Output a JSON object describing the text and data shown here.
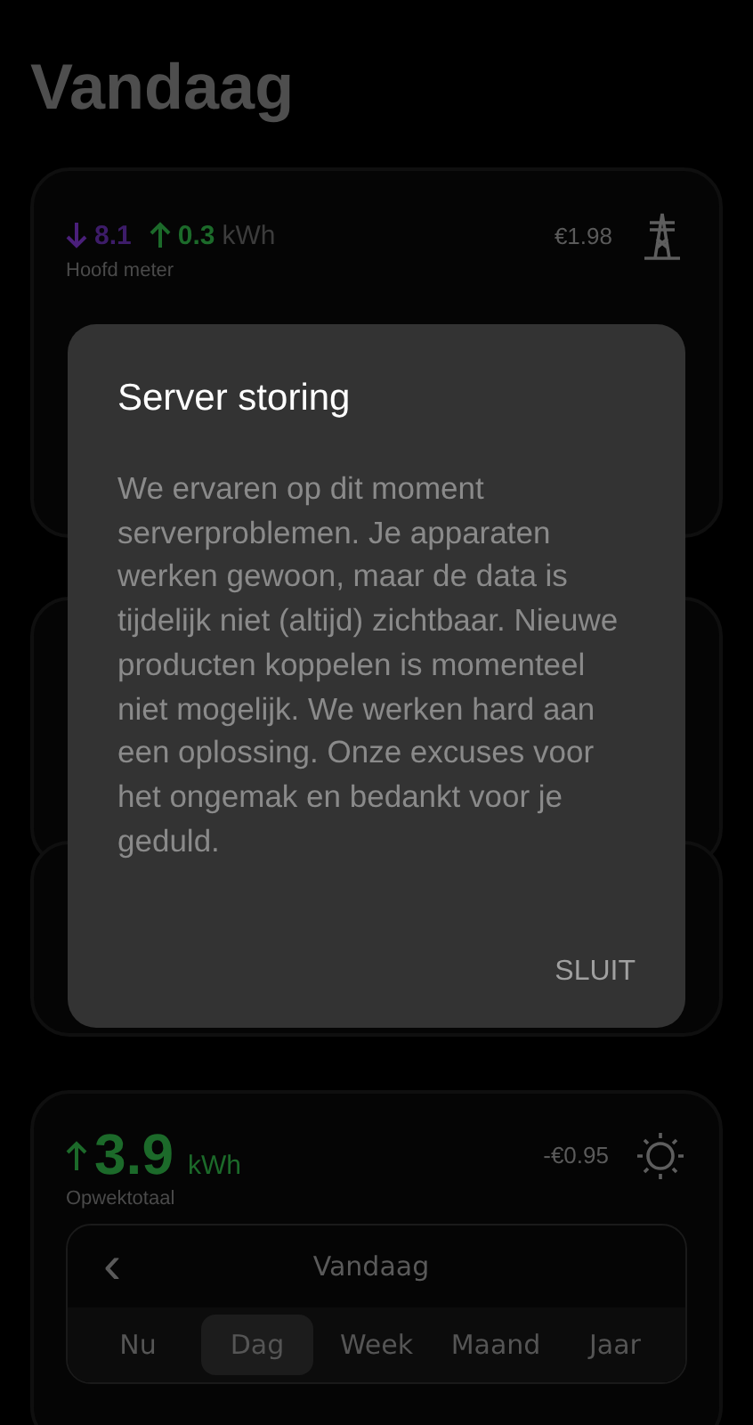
{
  "page_title": "Vandaag",
  "main_meter": {
    "import_value": "8.1",
    "export_value": "0.3",
    "unit": "kWh",
    "label": "Hoofd meter",
    "cost": "€1.98"
  },
  "production": {
    "value": "3.9",
    "unit": "kWh",
    "label": "Opwektotaal",
    "cost": "-€0.95"
  },
  "period": {
    "title": "Vandaag",
    "back_icon": "‹"
  },
  "tabs": [
    {
      "label": "Nu",
      "selected": false
    },
    {
      "label": "Dag",
      "selected": true
    },
    {
      "label": "Week",
      "selected": false
    },
    {
      "label": "Maand",
      "selected": false
    },
    {
      "label": "Jaar",
      "selected": false
    }
  ],
  "dialog": {
    "title": "Server storing",
    "message": "We ervaren op dit moment serverproblemen. Je apparaten werken gewoon, maar de data is tijdelijk niet (altijd) zichtbaar. Nieuwe producten koppelen is momenteel niet mogelijk. We werken hard aan een oplossing. Onze excuses voor het ongemak en bedankt voor je geduld.",
    "button": "SLUIT"
  }
}
